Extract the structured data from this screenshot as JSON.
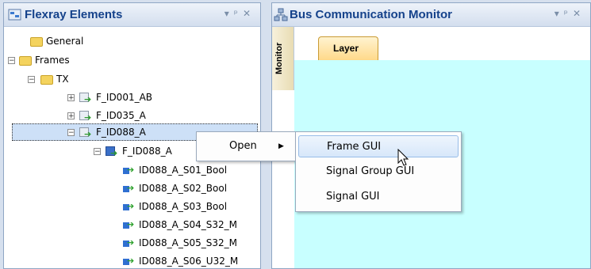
{
  "left_panel": {
    "title": "Flexray Elements",
    "header_buttons": [
      "▾",
      "ᵖ",
      "✕"
    ],
    "tree": {
      "general": "General",
      "frames": "Frames",
      "tx": "TX",
      "f_id001": "F_ID001_AB",
      "f_id035": "F_ID035_A",
      "f_id088": "F_ID088_A",
      "f_id088_child": "F_ID088_A",
      "signals": [
        "ID088_A_S01_Bool",
        "ID088_A_S02_Bool",
        "ID088_A_S03_Bool",
        "ID088_A_S04_S32_M",
        "ID088_A_S05_S32_M",
        "ID088_A_S06_U32_M"
      ]
    }
  },
  "right_panel": {
    "title": "Bus Communication Monitor",
    "vertical_tab": "Monitor",
    "tab": "Layer",
    "content_color": "#c8ffff"
  },
  "context_menu": {
    "open_label": "Open",
    "open_arrow": "▶"
  },
  "submenu": {
    "items": [
      "Frame GUI",
      "Signal Group GUI",
      "Signal GUI"
    ],
    "highlighted": "Frame GUI"
  }
}
